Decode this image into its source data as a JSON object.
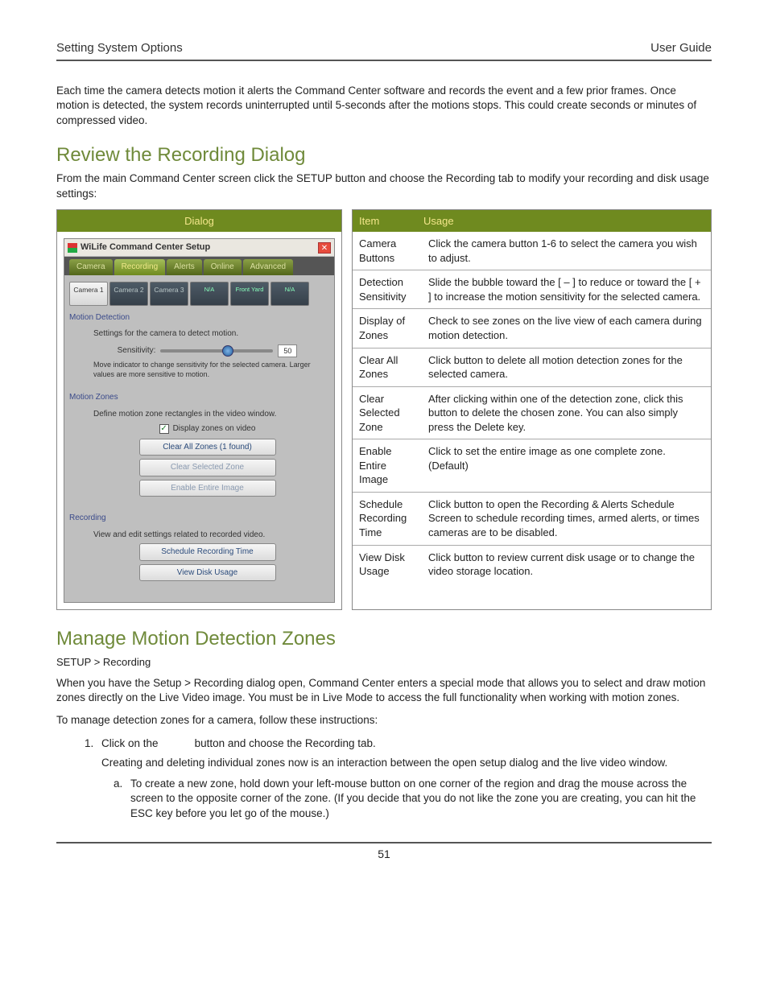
{
  "header": {
    "left": "Setting System Options",
    "right": "User Guide"
  },
  "intro": "Each time the camera detects motion it alerts the Command Center software and records the event and a few prior frames. Once motion is detected, the system records uninterrupted until 5-seconds after the motions stops. This could create seconds or minutes of compressed video.",
  "section1": {
    "title": "Review the Recording Dialog",
    "sub": "From the main Command Center screen click the SETUP button and choose the Recording tab to modify your recording and disk usage settings:",
    "dialog_header": "Dialog",
    "item_header": "Item",
    "usage_header": "Usage"
  },
  "dialog": {
    "title": "WiLife Command Center Setup",
    "tabs": [
      "Camera",
      "Recording",
      "Alerts",
      "Online",
      "Advanced"
    ],
    "cameras": [
      {
        "label": "Camera 1",
        "sub": ""
      },
      {
        "label": "Camera 2",
        "sub": ""
      },
      {
        "label": "Camera 3",
        "sub": ""
      },
      {
        "label": "",
        "sub": ""
      },
      {
        "label": "",
        "sub": "Front Yard"
      },
      {
        "label": "",
        "sub": "N/A"
      }
    ],
    "md_label": "Motion Detection",
    "md_desc": "Settings for the camera to detect motion.",
    "sens_label": "Sensitivity:",
    "sens_value": "50",
    "sens_note": "Move indicator to change sensitivity for the selected camera. Larger values are more sensitive to motion.",
    "mz_label": "Motion Zones",
    "mz_desc": "Define motion zone rectangles in the video window.",
    "mz_check": "Display zones on video",
    "btn_clear_all": "Clear All Zones (1 found)",
    "btn_clear_sel": "Clear Selected Zone",
    "btn_enable": "Enable Entire Image",
    "rec_label": "Recording",
    "rec_desc": "View and edit settings related to recorded video.",
    "btn_schedule": "Schedule Recording Time",
    "btn_disk": "View Disk Usage"
  },
  "usage_rows": [
    {
      "item": "Camera Buttons",
      "usage": "Click the camera button 1-6 to select the camera you wish to adjust."
    },
    {
      "item": "Detection Sensitivity",
      "usage": "Slide the bubble toward the [ – ] to reduce or toward the [ + ] to increase the motion sensitivity for the selected camera."
    },
    {
      "item": "Display of Zones",
      "usage": "Check to see zones on the live view of each camera during motion detection."
    },
    {
      "item": "Clear All Zones",
      "usage": "Click button to delete all motion detection zones for the selected camera."
    },
    {
      "item": "Clear Selected Zone",
      "usage": "After clicking within one of the detection zone, click this button to delete the chosen zone. You can also simply press the Delete key."
    },
    {
      "item": "Enable Entire Image",
      "usage": "Click to set the entire image as one complete zone. (Default)"
    },
    {
      "item": "Schedule Recording Time",
      "usage": "Click button to open the Recording & Alerts Schedule Screen to schedule recording times, armed alerts, or times cameras are to be disabled."
    },
    {
      "item": "View Disk Usage",
      "usage": "Click button to review current disk usage or to change the video storage location."
    }
  ],
  "section2": {
    "title": "Manage Motion Detection Zones",
    "crumb": "SETUP > Recording",
    "p1": "When you have the Setup > Recording dialog open, Command Center enters a special mode that allows you to select and draw motion zones directly on the Live Video image. You must be in Live Mode to access the full functionality when working with motion zones.",
    "p2": "To manage detection zones for a camera, follow these instructions:",
    "step1a": "Click on the",
    "step1b": "button and choose the Recording tab.",
    "step1_body": "Creating and deleting individual zones now is an interaction between the open setup dialog and the live video window.",
    "sub_a": "To create a new zone, hold down your left-mouse button on one corner of the region and drag the mouse across the screen to the opposite corner of the zone.  (If you decide that you do not like the zone you are creating, you can hit the ESC key before you let go of the mouse.)"
  },
  "page_number": "51"
}
